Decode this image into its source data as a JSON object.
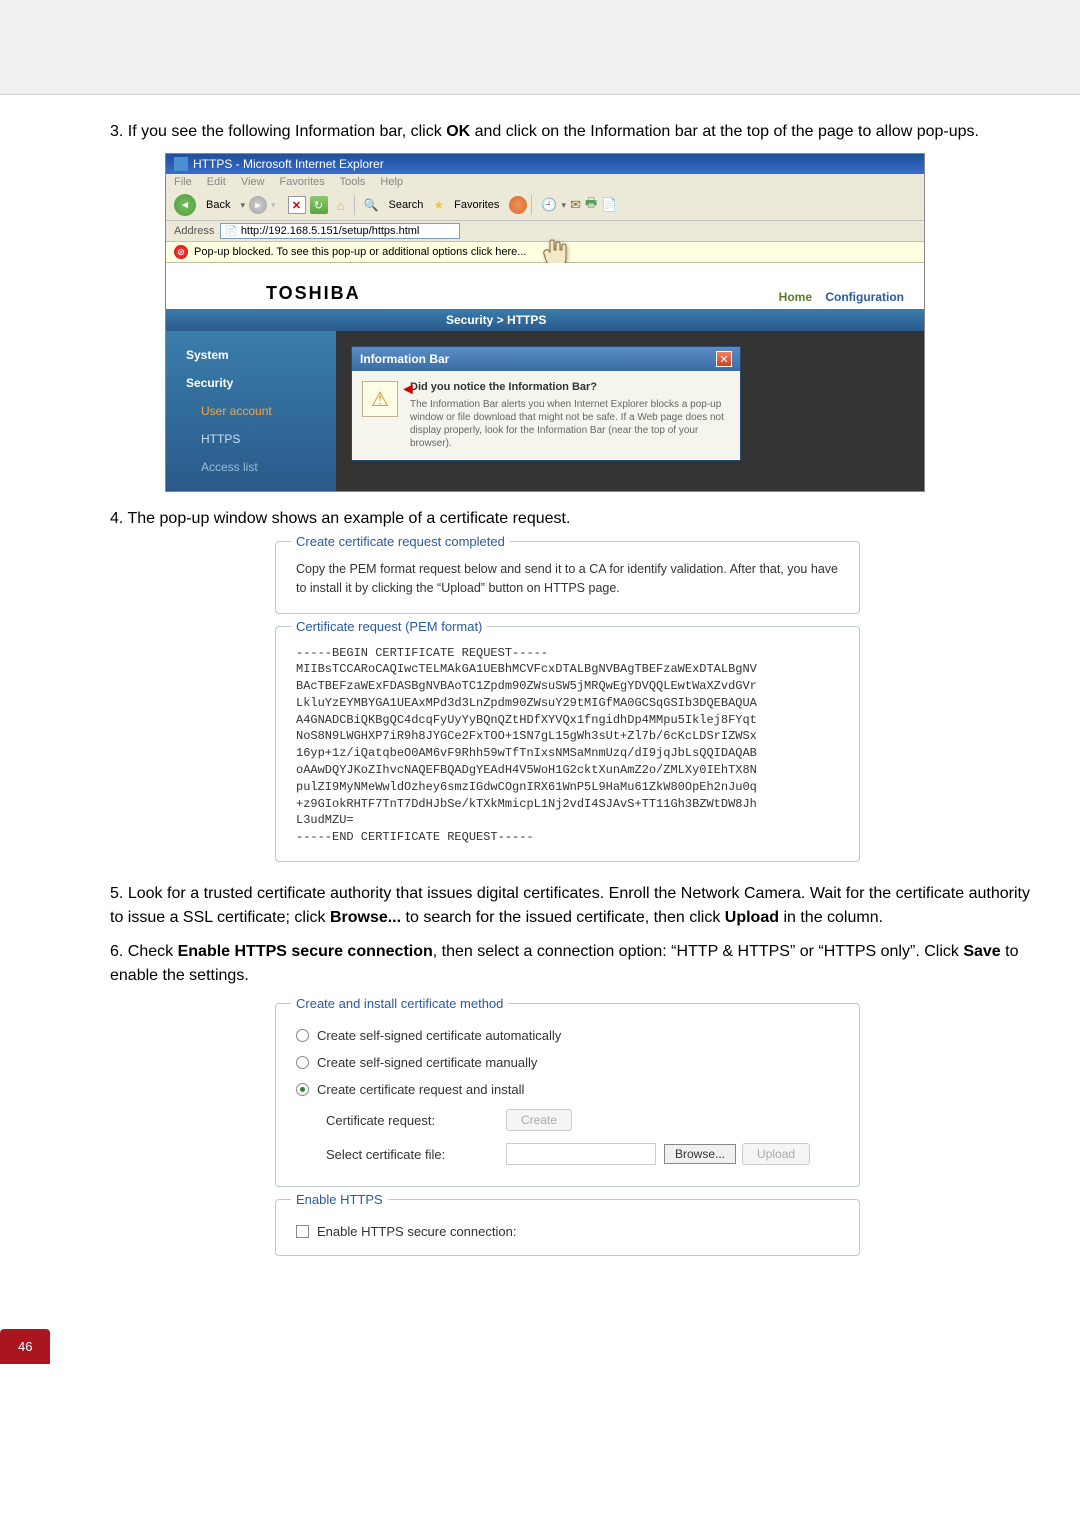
{
  "steps": {
    "s3_prefix": "3. ",
    "s3a": "If you see the following Information bar, click ",
    "s3_ok": "OK",
    "s3b": " and click on the Information bar at the top of the page to allow pop-ups.",
    "s4": "4.  The pop-up window shows an example of a certificate request.",
    "s5_prefix": "5. ",
    "s5a": "Look for a trusted certificate authority that issues digital certificates. Enroll the Network Camera. Wait for the certificate authority to issue a SSL certificate; click ",
    "s5_browse": "Browse...",
    "s5b": " to search for the issued certificate, then click ",
    "s5_upload": "Upload",
    "s5c": " in the column.",
    "s6_prefix": "6. ",
    "s6a": "Check ",
    "s6_bold1": "Enable HTTPS secure connection",
    "s6b": ", then select a connection option: “HTTP & HTTPS” or “HTTPS only”. Click ",
    "s6_save": "Save",
    "s6c": " to enable the settings."
  },
  "ie": {
    "title": "HTTPS - Microsoft Internet Explorer",
    "menus": [
      "File",
      "Edit",
      "View",
      "Favorites",
      "Tools",
      "Help"
    ],
    "back": "Back",
    "search": "Search",
    "favorites": "Favorites",
    "address_label": "Address",
    "address_value": "http://192.168.5.151/setup/https.html",
    "popup_msg": "Pop-up blocked. To see this pop-up or additional options click here..."
  },
  "toshiba": {
    "logo": "TOSHIBA",
    "home": "Home",
    "config": "Configuration",
    "breadcrumb": "Security > HTTPS",
    "sidebar": {
      "system": "System",
      "security": "Security",
      "user_account": "User account",
      "https": "HTTPS",
      "access_list": "Access list"
    }
  },
  "dialog": {
    "title": "Information Bar",
    "question": "Did you notice the Information Bar?",
    "body": "The Information Bar alerts you when Internet Explorer blocks a pop-up window or file download that might not be safe. If a Web page does not display properly, look for the Information Bar (near the top of your browser)."
  },
  "cert_request": {
    "legend1": "Create certificate request completed",
    "instruction": "Copy the PEM format request below and send it to a CA for identify validation. After that, you have to install it by clicking the “Upload” button on HTTPS page.",
    "legend2": "Certificate request (PEM format)",
    "pem": "-----BEGIN CERTIFICATE REQUEST-----\nMIIBsTCCARoCAQIwcTELMAkGA1UEBhMCVFcxDTALBgNVBAgTBEFzaWExDTALBgNV\nBAcTBEFzaWExFDASBgNVBAoTC1Zpdm90ZWsuSW5jMRQwEgYDVQQLEwtWaXZvdGVr\nLkluYzEYMBYGA1UEAxMPd3d3LnZpdm90ZWsuY29tMIGfMA0GCSqGSIb3DQEBAQUA\nA4GNADCBiQKBgQC4dcqFyUyYyBQnQZtHDfXYVQx1fngidhDp4MMpu5Iklej8FYqt\nNoS8N9LWGHXP7iR9h8JYGCe2FxTOO+1SN7gL15gWh3sUt+Zl7b/6cKcLDSrIZWSx\n16yp+1z/iQatqbeO0AM6vF9Rhh59wTfTnIxsNMSaMnmUzq/dI9jqJbLsQQIDAQAB\noAAwDQYJKoZIhvcNAQEFBQADgYEAdH4V5WoH1G2cktXunAmZ2o/ZMLXy0IEhTX8N\npulZI9MyNMeWwldOzhey6smzIGdwCOgnIRX61WnP5L9HaMu61ZkW80OpEh2nJu0q\n+z9GIokRHTF7TnT7DdHJbSe/kTXkMmicpL1Nj2vdI4SJAvS+TT11Gh3BZWtDW8Jh\nL3udMZU=\n-----END CERTIFICATE REQUEST-----"
  },
  "method": {
    "legend": "Create and install certificate method",
    "opt1": "Create self-signed certificate automatically",
    "opt2": "Create self-signed certificate manually",
    "opt3": "Create certificate request and install",
    "cert_req_label": "Certificate request:",
    "create_btn": "Create",
    "select_file_label": "Select certificate file:",
    "browse_btn": "Browse...",
    "upload_btn": "Upload"
  },
  "enable_https": {
    "legend": "Enable HTTPS",
    "checkbox_label": "Enable HTTPS secure connection:"
  },
  "page_number": "46"
}
